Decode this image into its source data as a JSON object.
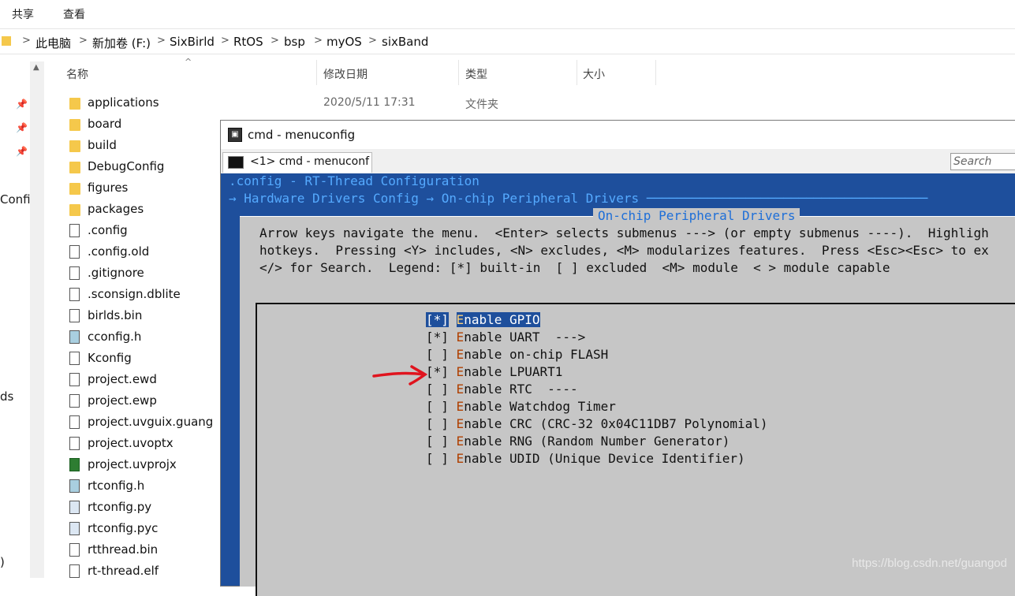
{
  "ribbon": {
    "tabs": [
      "共享",
      "查看"
    ]
  },
  "address": {
    "crumbs": [
      "此电脑",
      "新加卷 (F:)",
      "SixBirld",
      "RtOS",
      "bsp",
      "myOS",
      "sixBand"
    ],
    "separator": ">"
  },
  "nav": {
    "partial_labels": [
      "Confi",
      "ds",
      ")"
    ]
  },
  "columns": {
    "name": "名称",
    "date": "修改日期",
    "type": "类型",
    "size": "大小"
  },
  "first_row": {
    "date": "2020/5/11 17:31",
    "type": "文件夹"
  },
  "files": [
    {
      "name": "applications",
      "icon": "folder-icon"
    },
    {
      "name": "board",
      "icon": "folder-icon"
    },
    {
      "name": "build",
      "icon": "folder-icon"
    },
    {
      "name": "DebugConfig",
      "icon": "folder-icon"
    },
    {
      "name": "figures",
      "icon": "folder-icon"
    },
    {
      "name": "packages",
      "icon": "folder-icon"
    },
    {
      "name": ".config",
      "icon": "shortcut-file-icon"
    },
    {
      "name": ".config.old",
      "icon": "file-icon"
    },
    {
      "name": ".gitignore",
      "icon": "file-icon"
    },
    {
      "name": ".sconsign.dblite",
      "icon": "file-icon"
    },
    {
      "name": "birlds.bin",
      "icon": "file-icon"
    },
    {
      "name": "cconfig.h",
      "icon": "header-file-icon"
    },
    {
      "name": "Kconfig",
      "icon": "file-icon"
    },
    {
      "name": "project.ewd",
      "icon": "file-icon"
    },
    {
      "name": "project.ewp",
      "icon": "file-icon"
    },
    {
      "name": "project.uvguix.guang",
      "icon": "file-icon"
    },
    {
      "name": "project.uvoptx",
      "icon": "file-icon"
    },
    {
      "name": "project.uvprojx",
      "icon": "keil-project-icon"
    },
    {
      "name": "rtconfig.h",
      "icon": "header-file-icon"
    },
    {
      "name": "rtconfig.py",
      "icon": "python-file-icon"
    },
    {
      "name": "rtconfig.pyc",
      "icon": "python-file-icon"
    },
    {
      "name": "rtthread.bin",
      "icon": "file-icon"
    },
    {
      "name": "rt-thread.elf",
      "icon": "file-icon"
    }
  ],
  "cmd": {
    "title": "cmd - menuconfig",
    "tab_label": "<1> cmd - menuconf",
    "search_placeholder": "Search",
    "line1": ".config - RT-Thread Configuration",
    "line2": "→ Hardware Drivers Config → On-chip Peripheral Drivers ─────────────────────────────────────",
    "panel_title": "On-chip Peripheral Drivers",
    "help1": "Arrow keys navigate the menu.  <Enter> selects submenus ---> (or empty submenus ----).  Highligh",
    "help2": "hotkeys.  Pressing <Y> includes, <N> excludes, <M> modularizes features.  Press <Esc><Esc> to ex",
    "help3": "</> for Search.  Legend: [*] built-in  [ ] excluded  <M> module  < > module capable",
    "items": [
      {
        "mark": "[*]",
        "hotkey": "E",
        "rest": "nable GPIO",
        "selected": true
      },
      {
        "mark": "[*]",
        "hotkey": "E",
        "rest": "nable UART  --->"
      },
      {
        "mark": "[ ]",
        "hotkey": "E",
        "rest": "nable on-chip FLASH"
      },
      {
        "mark": "[*]",
        "hotkey": "E",
        "rest": "nable LPUART1"
      },
      {
        "mark": "[ ]",
        "hotkey": "E",
        "rest": "nable RTC  ----"
      },
      {
        "mark": "[ ]",
        "hotkey": "E",
        "rest": "nable Watchdog Timer"
      },
      {
        "mark": "[ ]",
        "hotkey": "E",
        "rest": "nable CRC (CRC-32 0x04C11DB7 Polynomial)"
      },
      {
        "mark": "[ ]",
        "hotkey": "E",
        "rest": "nable RNG (Random Number Generator)"
      },
      {
        "mark": "[ ]",
        "hotkey": "E",
        "rest": "nable UDID (Unique Device Identifier)"
      }
    ]
  },
  "watermark": "https://blog.csdn.net/guangod",
  "colors": {
    "console_bg": "#1e4f9c",
    "panel_bg": "#c6c6c6",
    "hotkey": "#b04000",
    "annotation_arrow": "#e0141e"
  }
}
